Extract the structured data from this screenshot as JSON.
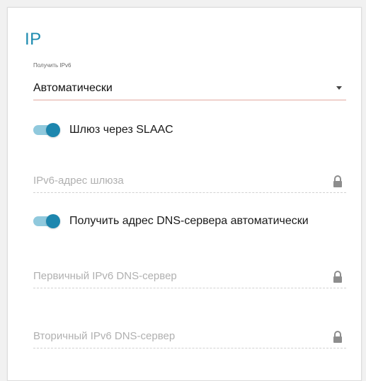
{
  "section": {
    "title": "IP"
  },
  "ipv6_select": {
    "label": "Получить IPv6",
    "value": "Автоматически"
  },
  "slaac_toggle": {
    "label": "Шлюз через SLAAC",
    "enabled": true
  },
  "gateway_field": {
    "placeholder": "IPv6-адрес шлюза",
    "icon": "lock-icon"
  },
  "dns_toggle": {
    "label": "Получить адрес DNS-сервера автоматически",
    "enabled": true
  },
  "primary_dns_field": {
    "placeholder": "Первичный IPv6 DNS-сервер",
    "icon": "lock-icon"
  },
  "secondary_dns_field": {
    "placeholder": "Вторичный IPv6 DNS-сервер",
    "icon": "lock-icon"
  },
  "colors": {
    "accent": "#1d86ae",
    "accent_light": "#90c9dd",
    "title": "#1d8bb0",
    "select_underline": "#e3a8a0",
    "placeholder": "#b0b0b0"
  }
}
